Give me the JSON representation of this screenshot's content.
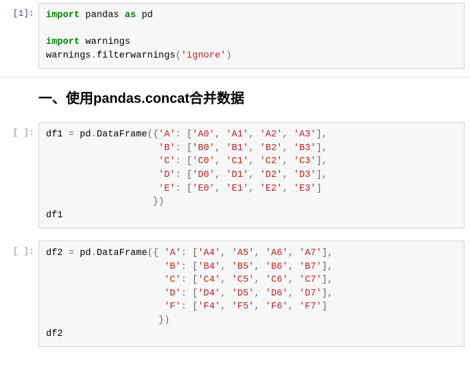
{
  "cells": [
    {
      "prompt": "[1]:",
      "tokens": [
        {
          "t": "import",
          "c": "kw"
        },
        {
          "t": " pandas ",
          "c": "nn"
        },
        {
          "t": "as",
          "c": "kw"
        },
        {
          "t": " pd",
          "c": "nn"
        },
        {
          "nl": true
        },
        {
          "nl": true
        },
        {
          "t": "import",
          "c": "kw"
        },
        {
          "t": " warnings",
          "c": "nn"
        },
        {
          "nl": true
        },
        {
          "t": "warnings",
          "c": "nn"
        },
        {
          "t": ".",
          "c": "op"
        },
        {
          "t": "filterwarnings",
          "c": "fn"
        },
        {
          "t": "(",
          "c": "op"
        },
        {
          "t": "'ignore'",
          "c": "s"
        },
        {
          "t": ")",
          "c": "op"
        }
      ]
    },
    {
      "prompt": "[ ]:",
      "tokens": [
        {
          "t": "df1 ",
          "c": "nn"
        },
        {
          "t": "=",
          "c": "op"
        },
        {
          "t": " pd",
          "c": "nn"
        },
        {
          "t": ".",
          "c": "op"
        },
        {
          "t": "DataFrame",
          "c": "fn"
        },
        {
          "t": "({",
          "c": "op"
        },
        {
          "t": "'A'",
          "c": "s"
        },
        {
          "t": ": [",
          "c": "op"
        },
        {
          "t": "'A0'",
          "c": "s"
        },
        {
          "t": ", ",
          "c": "op"
        },
        {
          "t": "'A1'",
          "c": "s"
        },
        {
          "t": ", ",
          "c": "op"
        },
        {
          "t": "'A2'",
          "c": "s"
        },
        {
          "t": ", ",
          "c": "op"
        },
        {
          "t": "'A3'",
          "c": "s"
        },
        {
          "t": "],",
          "c": "op"
        },
        {
          "nl": true
        },
        {
          "t": "                    ",
          "c": "nn"
        },
        {
          "t": "'B'",
          "c": "s"
        },
        {
          "t": ": [",
          "c": "op"
        },
        {
          "t": "'B0'",
          "c": "s"
        },
        {
          "t": ", ",
          "c": "op"
        },
        {
          "t": "'B1'",
          "c": "s"
        },
        {
          "t": ", ",
          "c": "op"
        },
        {
          "t": "'B2'",
          "c": "s"
        },
        {
          "t": ", ",
          "c": "op"
        },
        {
          "t": "'B3'",
          "c": "s"
        },
        {
          "t": "],",
          "c": "op"
        },
        {
          "nl": true
        },
        {
          "t": "                    ",
          "c": "nn"
        },
        {
          "t": "'C'",
          "c": "s"
        },
        {
          "t": ": [",
          "c": "op"
        },
        {
          "t": "'C0'",
          "c": "s"
        },
        {
          "t": ", ",
          "c": "op"
        },
        {
          "t": "'C1'",
          "c": "s"
        },
        {
          "t": ", ",
          "c": "op"
        },
        {
          "t": "'C2'",
          "c": "s"
        },
        {
          "t": ", ",
          "c": "op"
        },
        {
          "t": "'C3'",
          "c": "s"
        },
        {
          "t": "],",
          "c": "op"
        },
        {
          "nl": true
        },
        {
          "t": "                    ",
          "c": "nn"
        },
        {
          "t": "'D'",
          "c": "s"
        },
        {
          "t": ": [",
          "c": "op"
        },
        {
          "t": "'D0'",
          "c": "s"
        },
        {
          "t": ", ",
          "c": "op"
        },
        {
          "t": "'D1'",
          "c": "s"
        },
        {
          "t": ", ",
          "c": "op"
        },
        {
          "t": "'D2'",
          "c": "s"
        },
        {
          "t": ", ",
          "c": "op"
        },
        {
          "t": "'D3'",
          "c": "s"
        },
        {
          "t": "],",
          "c": "op"
        },
        {
          "nl": true
        },
        {
          "t": "                    ",
          "c": "nn"
        },
        {
          "t": "'E'",
          "c": "s"
        },
        {
          "t": ": [",
          "c": "op"
        },
        {
          "t": "'E0'",
          "c": "s"
        },
        {
          "t": ", ",
          "c": "op"
        },
        {
          "t": "'E1'",
          "c": "s"
        },
        {
          "t": ", ",
          "c": "op"
        },
        {
          "t": "'E2'",
          "c": "s"
        },
        {
          "t": ", ",
          "c": "op"
        },
        {
          "t": "'E3'",
          "c": "s"
        },
        {
          "t": "]",
          "c": "op"
        },
        {
          "nl": true
        },
        {
          "t": "                   })",
          "c": "op"
        },
        {
          "nl": true
        },
        {
          "t": "df1",
          "c": "nn"
        }
      ]
    },
    {
      "prompt": "[ ]:",
      "tokens": [
        {
          "t": "df2 ",
          "c": "nn"
        },
        {
          "t": "=",
          "c": "op"
        },
        {
          "t": " pd",
          "c": "nn"
        },
        {
          "t": ".",
          "c": "op"
        },
        {
          "t": "DataFrame",
          "c": "fn"
        },
        {
          "t": "({ ",
          "c": "op"
        },
        {
          "t": "'A'",
          "c": "s"
        },
        {
          "t": ": [",
          "c": "op"
        },
        {
          "t": "'A4'",
          "c": "s"
        },
        {
          "t": ", ",
          "c": "op"
        },
        {
          "t": "'A5'",
          "c": "s"
        },
        {
          "t": ", ",
          "c": "op"
        },
        {
          "t": "'A6'",
          "c": "s"
        },
        {
          "t": ", ",
          "c": "op"
        },
        {
          "t": "'A7'",
          "c": "s"
        },
        {
          "t": "],",
          "c": "op"
        },
        {
          "nl": true
        },
        {
          "t": "                     ",
          "c": "nn"
        },
        {
          "t": "'B'",
          "c": "s"
        },
        {
          "t": ": [",
          "c": "op"
        },
        {
          "t": "'B4'",
          "c": "s"
        },
        {
          "t": ", ",
          "c": "op"
        },
        {
          "t": "'B5'",
          "c": "s"
        },
        {
          "t": ", ",
          "c": "op"
        },
        {
          "t": "'B6'",
          "c": "s"
        },
        {
          "t": ", ",
          "c": "op"
        },
        {
          "t": "'B7'",
          "c": "s"
        },
        {
          "t": "],",
          "c": "op"
        },
        {
          "nl": true
        },
        {
          "t": "                     ",
          "c": "nn"
        },
        {
          "t": "'C'",
          "c": "s"
        },
        {
          "t": ": [",
          "c": "op"
        },
        {
          "t": "'C4'",
          "c": "s"
        },
        {
          "t": ", ",
          "c": "op"
        },
        {
          "t": "'C5'",
          "c": "s"
        },
        {
          "t": ", ",
          "c": "op"
        },
        {
          "t": "'C6'",
          "c": "s"
        },
        {
          "t": ", ",
          "c": "op"
        },
        {
          "t": "'C7'",
          "c": "s"
        },
        {
          "t": "],",
          "c": "op"
        },
        {
          "nl": true
        },
        {
          "t": "                     ",
          "c": "nn"
        },
        {
          "t": "'D'",
          "c": "s"
        },
        {
          "t": ": [",
          "c": "op"
        },
        {
          "t": "'D4'",
          "c": "s"
        },
        {
          "t": ", ",
          "c": "op"
        },
        {
          "t": "'D5'",
          "c": "s"
        },
        {
          "t": ", ",
          "c": "op"
        },
        {
          "t": "'D6'",
          "c": "s"
        },
        {
          "t": ", ",
          "c": "op"
        },
        {
          "t": "'D7'",
          "c": "s"
        },
        {
          "t": "],",
          "c": "op"
        },
        {
          "nl": true
        },
        {
          "t": "                     ",
          "c": "nn"
        },
        {
          "t": "'F'",
          "c": "s"
        },
        {
          "t": ": [",
          "c": "op"
        },
        {
          "t": "'F4'",
          "c": "s"
        },
        {
          "t": ", ",
          "c": "op"
        },
        {
          "t": "'F5'",
          "c": "s"
        },
        {
          "t": ", ",
          "c": "op"
        },
        {
          "t": "'F6'",
          "c": "s"
        },
        {
          "t": ", ",
          "c": "op"
        },
        {
          "t": "'F7'",
          "c": "s"
        },
        {
          "t": "]",
          "c": "op"
        },
        {
          "nl": true
        },
        {
          "t": "                    })",
          "c": "op"
        },
        {
          "nl": true
        },
        {
          "t": "df2",
          "c": "nn"
        }
      ]
    }
  ],
  "heading": "一、使用pandas.concat合并数据"
}
